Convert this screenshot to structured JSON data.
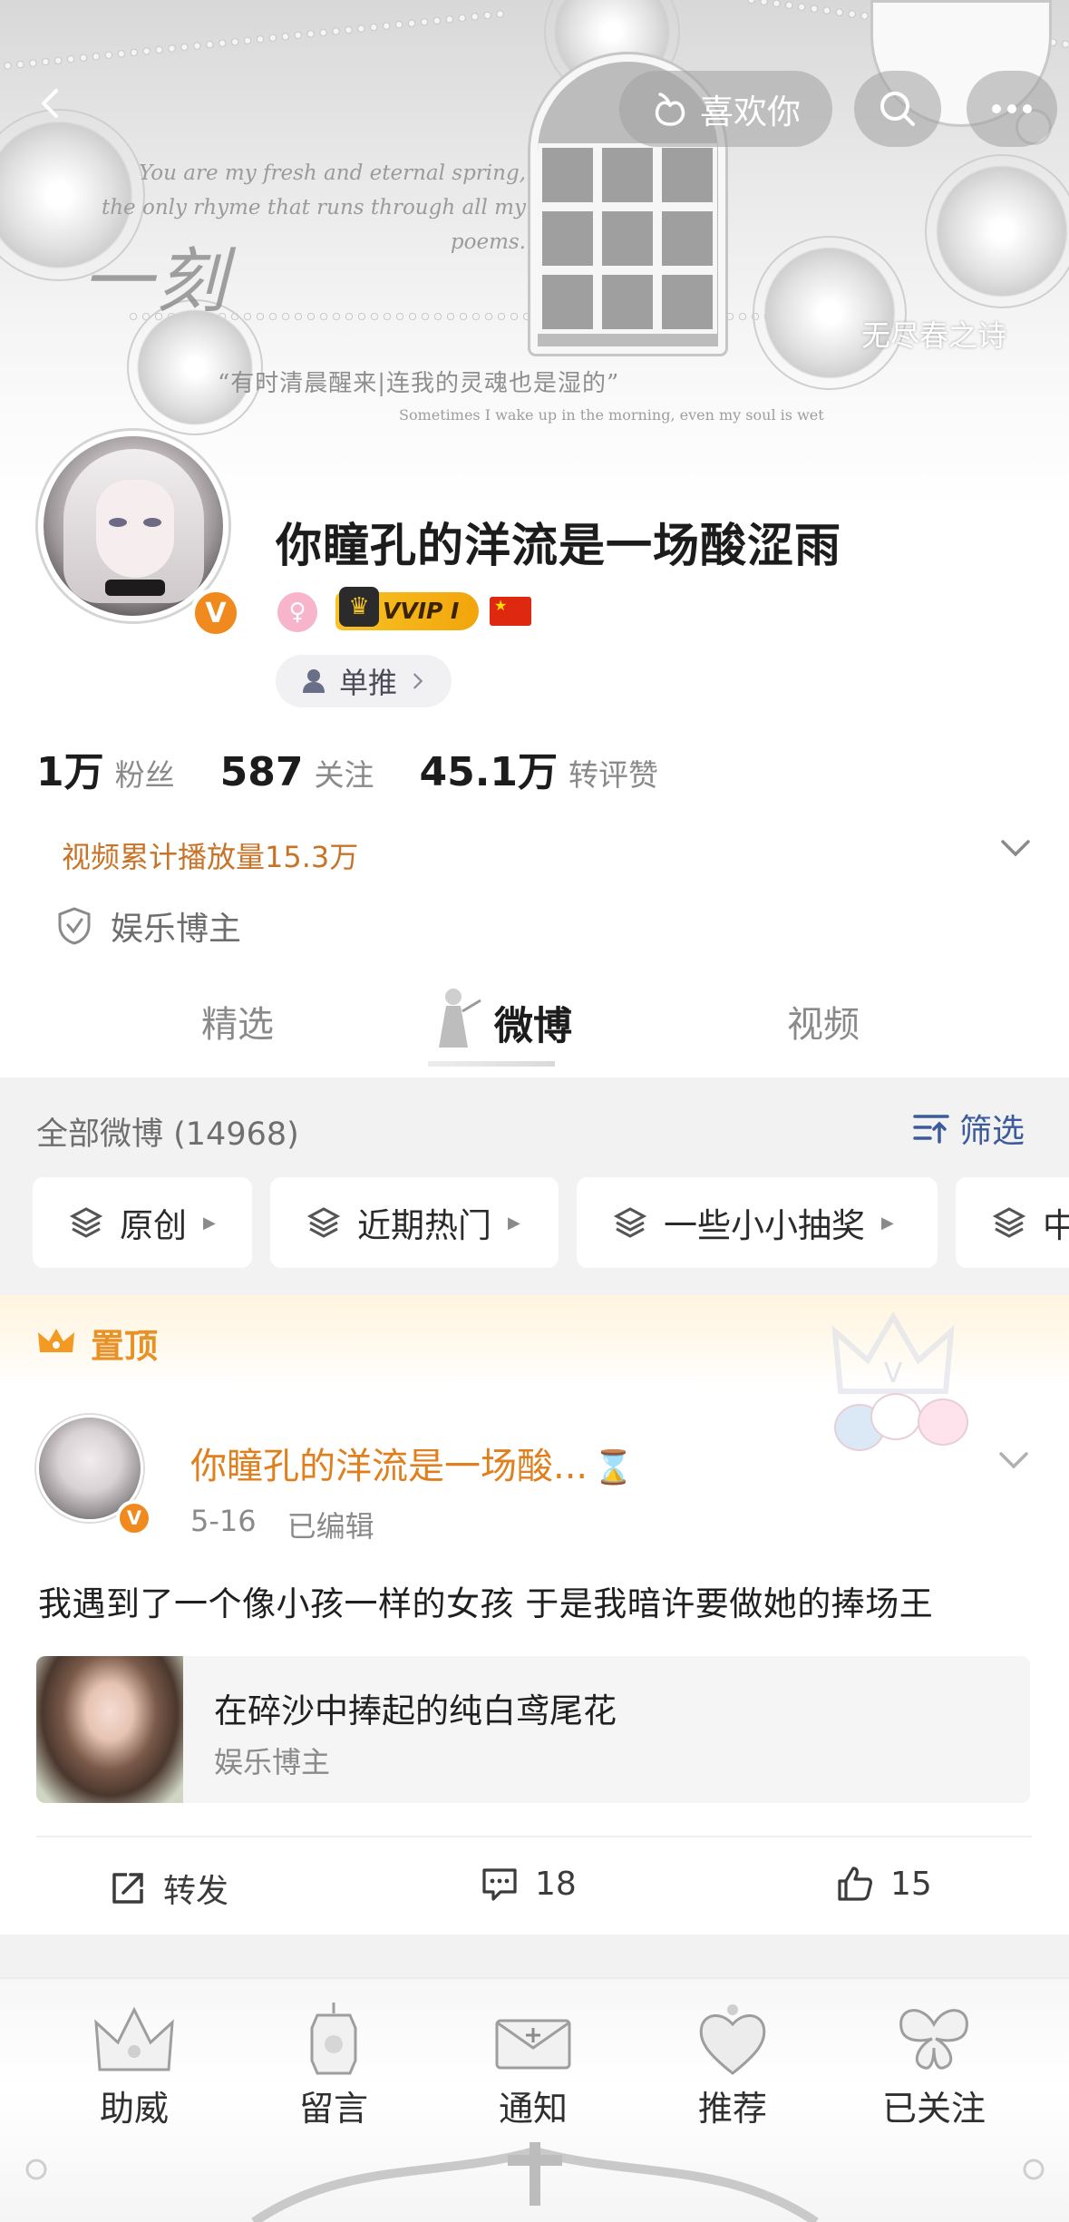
{
  "header": {
    "like_label": "喜欢你",
    "banner_quote": "You are my fresh and eternal spring, the only rhyme that runs through all my poems.",
    "banner_signature": "一刻",
    "banner_line_cn": "“有时清晨醒来|连我的灵魂也是湿的”",
    "banner_line_en": "Sometimes I wake up in the morning, even my soul is wet",
    "banner_right": "无尽春之诗"
  },
  "profile": {
    "username": "你瞳孔的洋流是一场酸涩雨",
    "verify_mark": "V",
    "vip_label": "VVIP Ⅰ",
    "tag_chip": "单推",
    "stats": [
      {
        "num": "1万",
        "label": "粉丝"
      },
      {
        "num": "587",
        "label": "关注"
      },
      {
        "num": "45.1万",
        "label": "转评赞"
      }
    ],
    "video_stat": "视频累计播放量15.3万",
    "role": "娱乐博主"
  },
  "tabs": [
    {
      "label": "精选"
    },
    {
      "label": "微博"
    },
    {
      "label": "视频"
    }
  ],
  "feed": {
    "all_count": "全部微博 (14968)",
    "filter_label": "筛选",
    "categories": [
      {
        "label": "原创"
      },
      {
        "label": "近期热门"
      },
      {
        "label": "一些小小抽奖"
      },
      {
        "label": "中"
      }
    ]
  },
  "pinned": {
    "label": "置顶",
    "author": "你瞳孔的洋流是一场酸...",
    "hourglass": "⌛",
    "date": "5-16",
    "edited": "已编辑",
    "text": "我遇到了一个像小孩一样的女孩 于是我暗许要做她的捧场王",
    "link_title": "在碎沙中捧起的纯白鸢尾花",
    "link_sub": "娱乐博主",
    "repost_label": "转发",
    "comment_count": "18",
    "like_count": "15"
  },
  "bottom_nav": [
    {
      "label": "助威"
    },
    {
      "label": "留言"
    },
    {
      "label": "通知"
    },
    {
      "label": "推荐"
    },
    {
      "label": "已关注"
    }
  ],
  "colors": {
    "accent_orange": "#e07f1d",
    "verify_orange": "#f08a1e",
    "filter_blue": "#3d5a9b",
    "vip_gold": "#f2a50b"
  }
}
